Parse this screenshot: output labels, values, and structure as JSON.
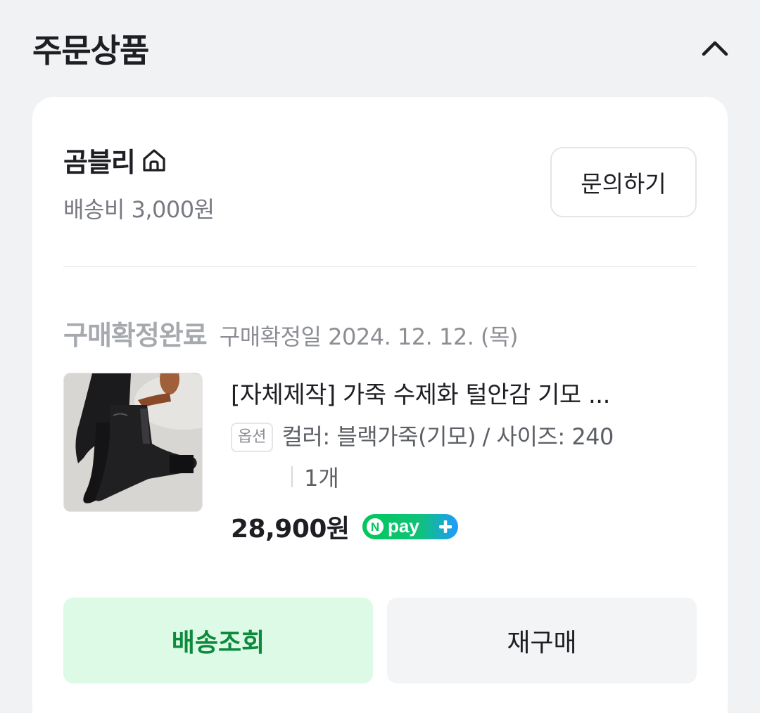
{
  "section": {
    "title": "주문상품",
    "collapse_icon": "chevron-up-icon"
  },
  "seller": {
    "name": "곰블리",
    "home_icon": "home-icon",
    "shipping_fee": "배송비 3,000원",
    "inquiry_label": "문의하기"
  },
  "order": {
    "status": "구매확정완료",
    "confirm_date": "구매확정일 2024. 12. 12. (목)"
  },
  "product": {
    "title": "[자체제작] 가죽 수제화 털안감 기모 ...",
    "option_badge": "옵션",
    "option_text": "컬러: 블랙가죽(기모) / 사이즈: 240",
    "quantity": "1개",
    "price": "28,900원",
    "pay_badge": "Npay+"
  },
  "actions": {
    "track_label": "배송조회",
    "rebuy_label": "재구매"
  },
  "colors": {
    "track_bg": "#dcfae6",
    "track_text": "#0d8a3d",
    "npay_green": "#03c75a",
    "npay_blue": "#1e9bff"
  }
}
